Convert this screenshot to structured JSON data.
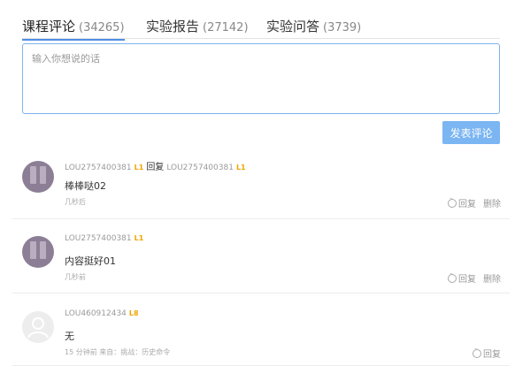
{
  "tabs": [
    {
      "label": "课程评论",
      "count": "(34265)"
    },
    {
      "label": "实验报告",
      "count": "(27142)"
    },
    {
      "label": "实验问答",
      "count": "(3739)"
    }
  ],
  "comment_input": {
    "placeholder": "输入你想说的话"
  },
  "submit_button": {
    "label": "发表评论"
  },
  "comments": [
    {
      "user": "LOU2757400381",
      "level": "L1",
      "reply_word": "回复",
      "reply_to": "LOU2757400381",
      "reply_to_level": "L1",
      "content": "棒棒哒02",
      "time": "几秒后",
      "reply_label": "回复",
      "delete_label": "删除"
    },
    {
      "user": "LOU2757400381",
      "level": "L1",
      "content": "内容挺好01",
      "time": "几秒前",
      "reply_label": "回复",
      "delete_label": "删除"
    },
    {
      "user": "LOU460912434",
      "level": "L8",
      "content": "无",
      "time": "15 分钟前  来自：挑战：历史命令",
      "reply_label": "回复"
    }
  ],
  "colors": {
    "accent": "#4f8fe8",
    "button": "#7bb5f2",
    "level": "#f0a500"
  }
}
